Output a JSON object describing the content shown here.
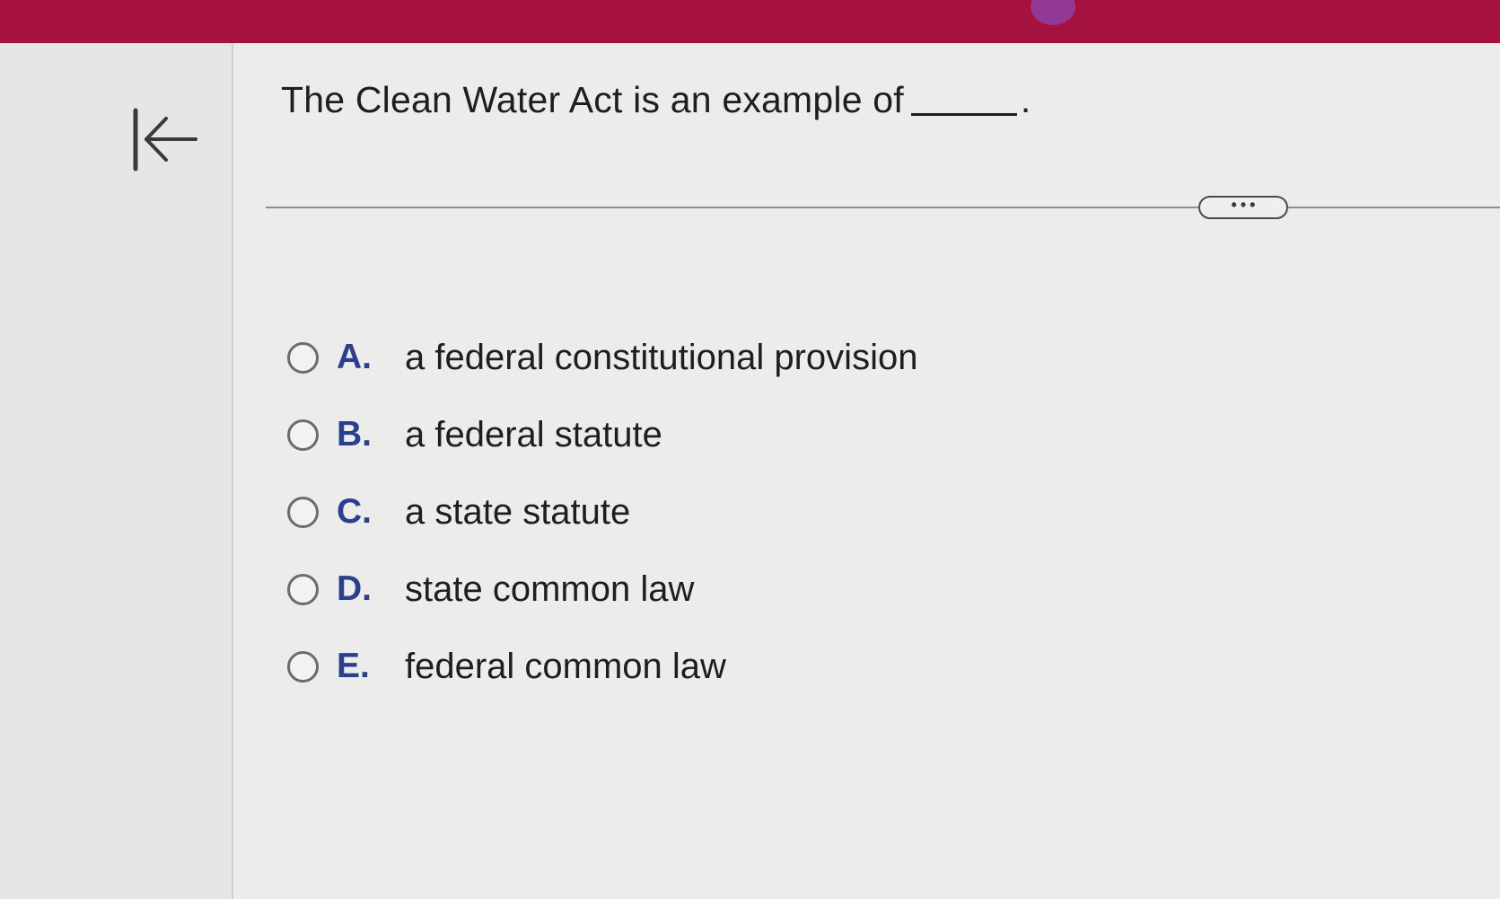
{
  "question": {
    "text": "The Clean Water Act is an example of",
    "end_punctuation": "."
  },
  "more_button": {
    "label": "•••",
    "icon": "ellipsis-icon"
  },
  "back_button": {
    "icon": "back-to-start-icon"
  },
  "options": [
    {
      "letter": "A.",
      "text": "a federal constitutional provision",
      "selected": false
    },
    {
      "letter": "B.",
      "text": "a federal statute",
      "selected": false
    },
    {
      "letter": "C.",
      "text": "a state statute",
      "selected": false
    },
    {
      "letter": "D.",
      "text": "state common law",
      "selected": false
    },
    {
      "letter": "E.",
      "text": "federal common law",
      "selected": false
    }
  ],
  "colors": {
    "header": "#a5123f",
    "option_letter": "#2a3f8e",
    "text": "#1e1e1e"
  }
}
